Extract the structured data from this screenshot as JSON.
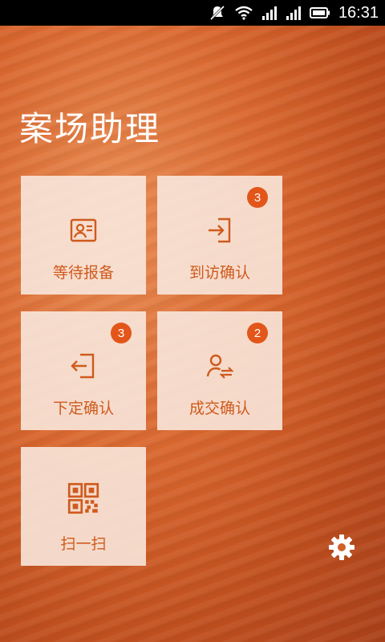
{
  "status_bar": {
    "time": "16:31",
    "icons": [
      "mute-icon",
      "wifi-icon",
      "signal-icon",
      "signal-icon",
      "battery-icon"
    ]
  },
  "app": {
    "title": "案场助理"
  },
  "tiles": [
    {
      "label": "等待报备",
      "icon": "id-card-icon",
      "badge": ""
    },
    {
      "label": "到访确认",
      "icon": "sign-in-icon",
      "badge": "3"
    },
    {
      "label": "下定确认",
      "icon": "sign-out-icon",
      "badge": "3"
    },
    {
      "label": "成交确认",
      "icon": "user-transfer-icon",
      "badge": "2"
    },
    {
      "label": "扫一扫",
      "icon": "qr-code-icon",
      "badge": ""
    }
  ],
  "settings": {
    "icon": "gear-icon"
  },
  "colors": {
    "accent": "#cf5a1d",
    "badge": "#e3561a",
    "tile_bg": "#f8e7dc"
  }
}
